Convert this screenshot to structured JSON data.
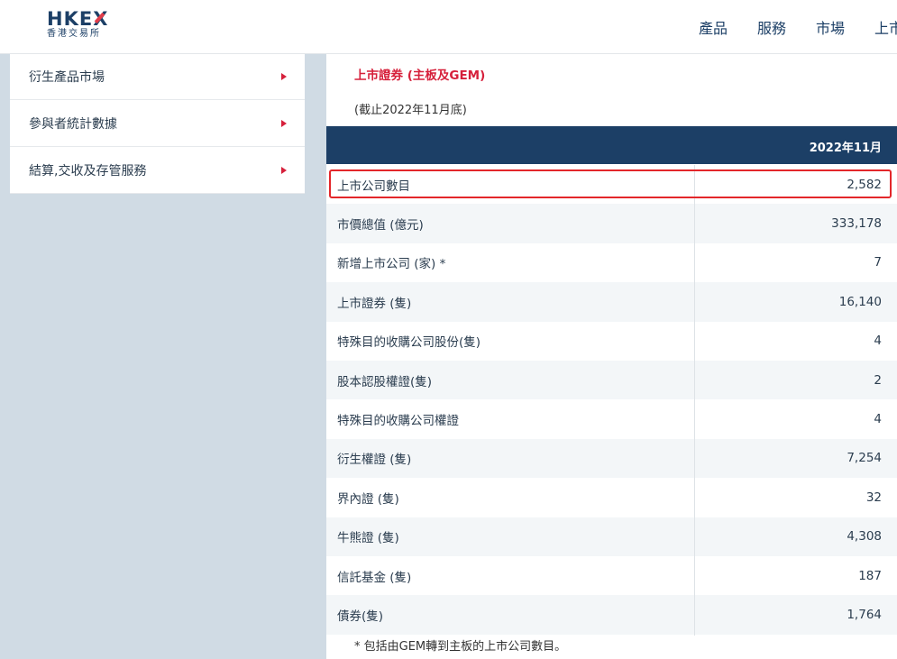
{
  "header": {
    "logo_text": "HKEX",
    "logo_subtext": "香港交易所",
    "nav": [
      "產品",
      "服務",
      "市場",
      "上市"
    ]
  },
  "sidebar": {
    "items": [
      {
        "label": "衍生產品市場"
      },
      {
        "label": "參與者統計數據"
      },
      {
        "label": "結算,交收及存管服務"
      }
    ]
  },
  "main": {
    "section_title": "上市證券 (主板及GEM)",
    "as_of": "(截止2022年11月底)",
    "table": {
      "column_header": "2022年11月",
      "rows": [
        {
          "label": "上市公司數目",
          "value": "2,582"
        },
        {
          "label": "市價總值 (億元)",
          "value": "333,178"
        },
        {
          "label": "新增上市公司 (家) *",
          "value": "7"
        },
        {
          "label": "上市證券 (隻)",
          "value": "16,140"
        },
        {
          "label": "特殊目的收購公司股份(隻)",
          "value": "4"
        },
        {
          "label": "股本認股權證(隻)",
          "value": "2"
        },
        {
          "label": "特殊目的收購公司權證",
          "value": "4"
        },
        {
          "label": "衍生權證 (隻)",
          "value": "7,254"
        },
        {
          "label": "界內證 (隻)",
          "value": "32"
        },
        {
          "label": "牛熊證 (隻)",
          "value": "4,308"
        },
        {
          "label": "信託基金 (隻)",
          "value": "187"
        },
        {
          "label": "債券(隻)",
          "value": "1,764"
        }
      ]
    },
    "footnote": "* 包括由GEM轉到主板的上市公司數目。"
  },
  "colors": {
    "brand_navy": "#1c3f66",
    "accent_red": "#d6203b",
    "highlight_border": "#e3262a"
  }
}
